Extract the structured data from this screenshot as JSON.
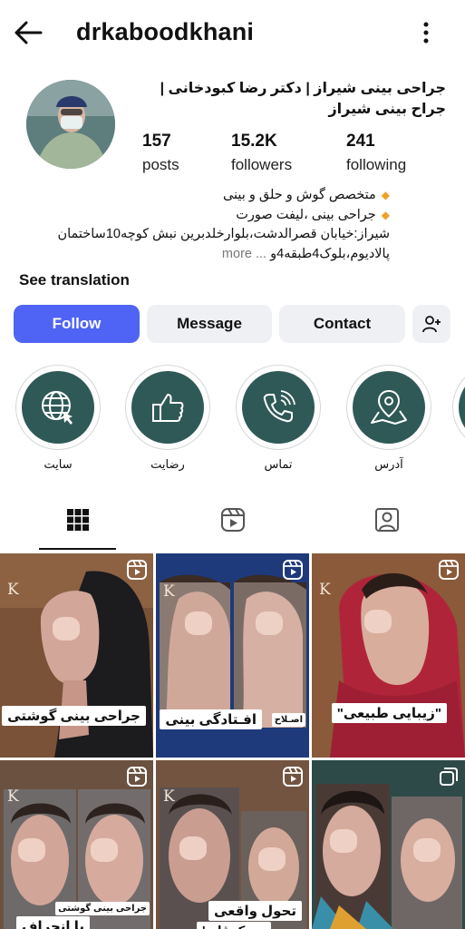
{
  "header": {
    "username": "drkaboodkhani",
    "back_icon": "arrow-left-icon",
    "more_icon": "more-vertical-icon"
  },
  "profile": {
    "name": "جراحی بینی شیراز | دکتر رضا کبودخانی | جراح بینی شیراز",
    "stats": {
      "posts": {
        "value": "157",
        "label": "posts"
      },
      "followers": {
        "value": "15.2K",
        "label": "followers"
      },
      "following": {
        "value": "241",
        "label": "following"
      }
    },
    "bio": {
      "line1": "متخصص گوش و حلق و بینی",
      "line2": "جراحی بینی ،لیفت صورت",
      "line3": "شیراز:خیابان قصرالدشت،بلوارخلدبرین نبش کوچه10ساختمان",
      "line4": "پالادیوم،بلوک4طبقه4و",
      "more": "... more"
    },
    "see_translation": "See translation"
  },
  "actions": {
    "follow": "Follow",
    "message": "Message",
    "contact": "Contact",
    "add_user_icon": "add-user-icon"
  },
  "highlights": [
    {
      "label": "سایت",
      "icon": "globe-cursor-icon"
    },
    {
      "label": "رضایت",
      "icon": "thumbs-up-icon"
    },
    {
      "label": "تماس",
      "icon": "phone-icon"
    },
    {
      "label": "آدرس",
      "icon": "map-pin-icon"
    }
  ],
  "tabs": [
    {
      "name": "grid",
      "icon": "grid-icon"
    },
    {
      "name": "reels",
      "icon": "reels-icon"
    },
    {
      "name": "tagged",
      "icon": "tagged-user-icon"
    }
  ],
  "posts": [
    {
      "caption": "جراحی بینی گوشتی",
      "type": "reel"
    },
    {
      "caption": "افـتادگی بینی",
      "caption_small": "اصـلاح",
      "type": "reel"
    },
    {
      "caption": "\"زیبایی طبیعی\"",
      "type": "reel"
    },
    {
      "caption": "با انحراف",
      "caption_small": "جراحی بینی گوشتی",
      "type": "reel"
    },
    {
      "caption": "تحول واقعی",
      "caption_small": "در یک قاب!",
      "type": "reel"
    },
    {
      "caption": "",
      "type": "carousel"
    }
  ],
  "colors": {
    "accent": "#4f63f5",
    "highlight": "#2f5957",
    "bio_diamond": "#f0a02a"
  }
}
